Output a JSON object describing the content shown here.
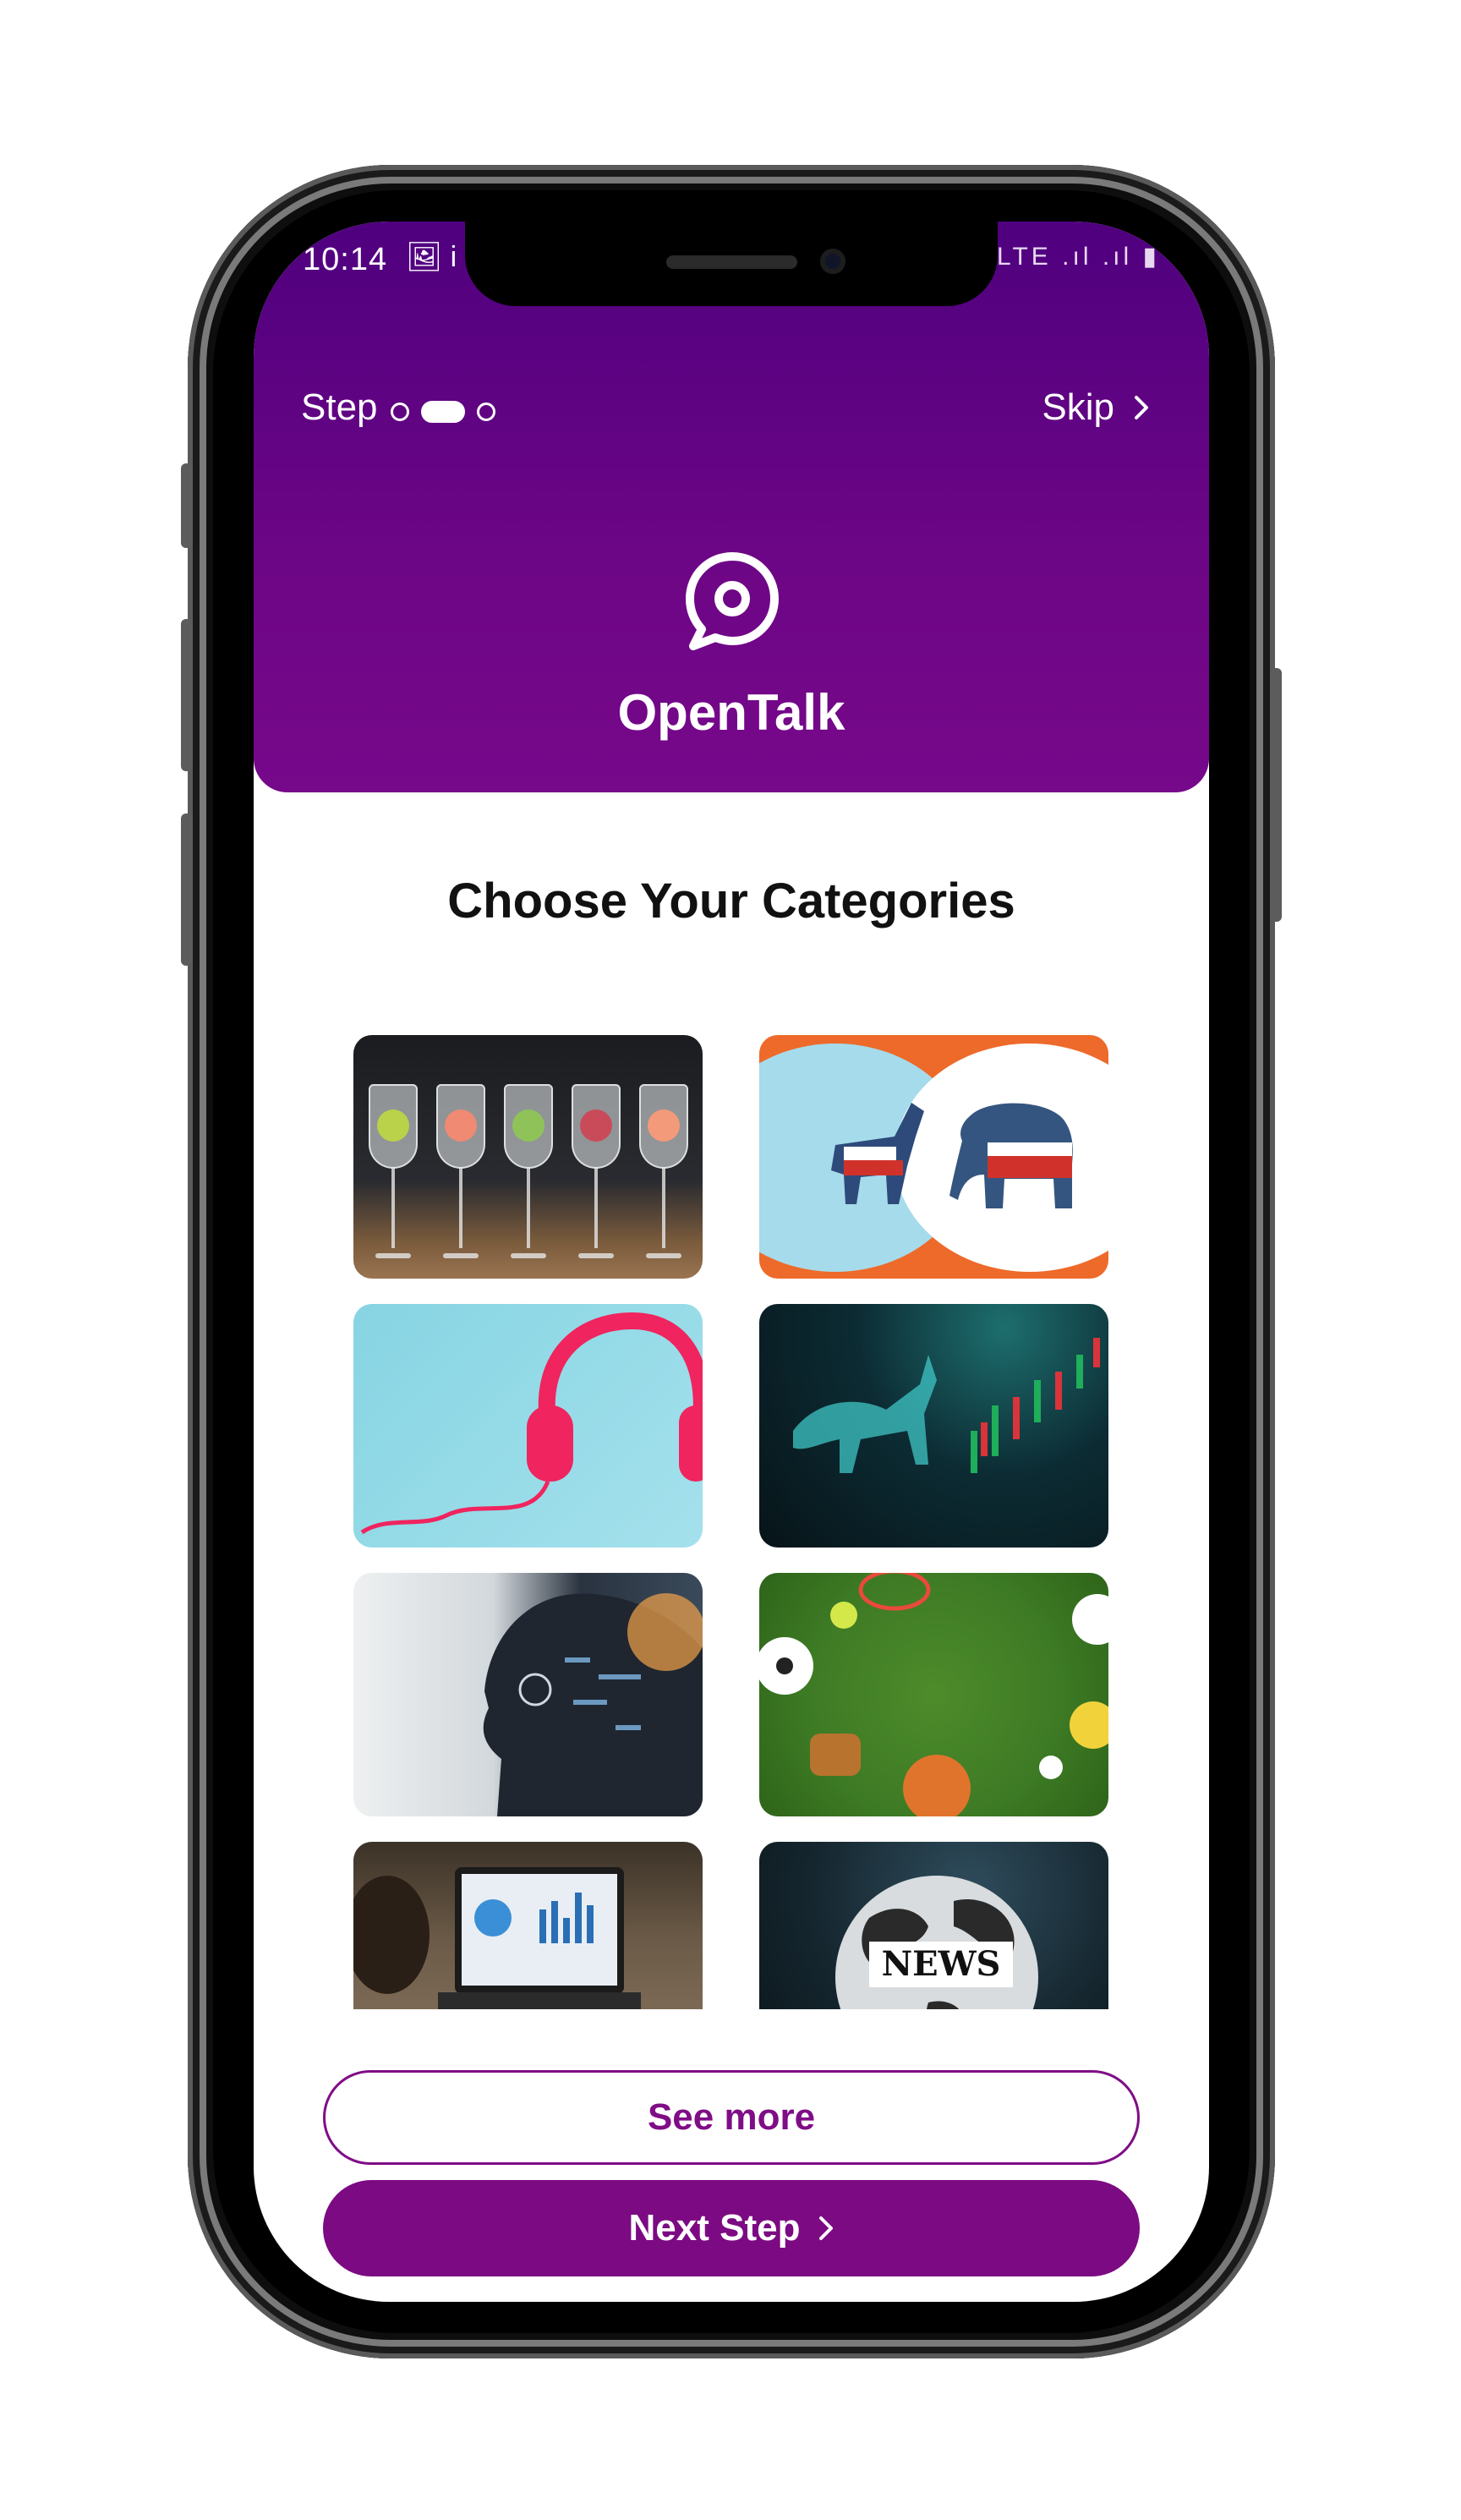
{
  "status_bar": {
    "time": "10:14",
    "left_icons": "🖼 i",
    "right_icons": "✱ LTE .ıl .ıl ▮"
  },
  "header": {
    "step_label": "Step",
    "progress": {
      "current_step": 2,
      "total_steps": 3
    },
    "skip_label": "Skip",
    "brand_name": "OpenTalk",
    "logo_icon": "chat-bubble-icon",
    "gradient_top": "#4f007f",
    "gradient_bottom": "#76088a"
  },
  "main": {
    "title": "Choose Your Categories",
    "categories": [
      {
        "image": "cocktail-glasses-image"
      },
      {
        "image": "politics-donkey-elephant-image"
      },
      {
        "image": "pink-headphones-image"
      },
      {
        "image": "stock-market-bull-image"
      },
      {
        "image": "ai-technology-face-image"
      },
      {
        "image": "sports-balls-grass-image"
      },
      {
        "image": "business-laptop-charts-image"
      },
      {
        "image": "news-globe-image",
        "text": "NEWS"
      }
    ]
  },
  "actions": {
    "see_more_label": "See more",
    "next_step_label": "Next Step",
    "accent_color": "#7c0a82"
  }
}
